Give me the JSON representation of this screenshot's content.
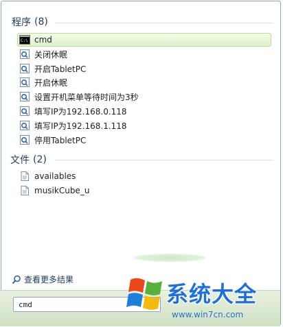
{
  "programs": {
    "heading": "程序",
    "count": "(8)",
    "items": [
      {
        "label": "cmd",
        "icon": "console-icon",
        "selected": true
      },
      {
        "label": "关闭休眠",
        "icon": "shortcut-icon"
      },
      {
        "label": "开启TabletPC",
        "icon": "shortcut-icon"
      },
      {
        "label": "开启休眠",
        "icon": "shortcut-icon"
      },
      {
        "label": "设置开机菜单等待时间为3秒",
        "icon": "shortcut-icon"
      },
      {
        "label": "填写IP为192.168.0.118",
        "icon": "shortcut-icon"
      },
      {
        "label": "填写IP为192.168.1.118",
        "icon": "shortcut-icon"
      },
      {
        "label": "停用TabletPC",
        "icon": "shortcut-icon"
      }
    ]
  },
  "files": {
    "heading": "文件",
    "count": "(2)",
    "items": [
      {
        "label": "availables",
        "icon": "document-icon"
      },
      {
        "label": "musikCube_u",
        "icon": "document-icon"
      }
    ]
  },
  "see_more": {
    "label": "查看更多结果",
    "icon": "search-icon"
  },
  "search": {
    "value": "cmd"
  },
  "watermark": {
    "title": "系统大全",
    "url": "www.win7cn.com"
  },
  "colors": {
    "selected_bg": "#def3c9",
    "selected_border": "#b7dc93",
    "heading": "#1e395b"
  }
}
